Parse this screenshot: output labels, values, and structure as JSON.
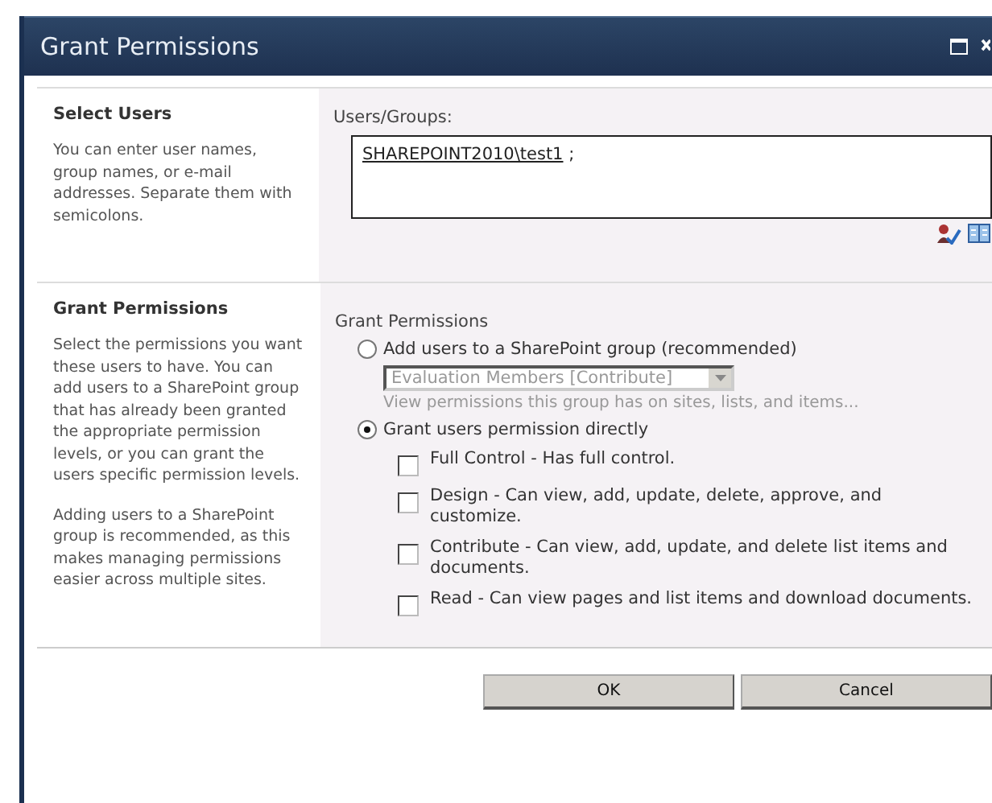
{
  "window": {
    "title": "Grant Permissions"
  },
  "sections": [
    {
      "heading": "Select Users",
      "paragraphs": [
        "You can enter user names, group names, or e-mail addresses. Separate them with semicolons."
      ]
    },
    {
      "heading": "Grant Permissions",
      "paragraphs": [
        "Select the permissions you want these users to have. You can add users to a SharePoint group that has already been granted the appropriate permission levels, or you can grant the users specific permission levels.",
        "Adding users to a SharePoint group is recommended, as this makes managing permissions easier across multiple sites."
      ]
    }
  ],
  "users": {
    "label": "Users/Groups:",
    "value": "SHAREPOINT2010\\test1",
    "separator": ";"
  },
  "grant": {
    "label": "Grant Permissions",
    "options": [
      {
        "label": "Add users to a SharePoint group (recommended)",
        "selected": false
      },
      {
        "label": "Grant users permission directly",
        "selected": true
      }
    ],
    "group_select": {
      "value": "Evaluation Members [Contribute]",
      "disabled": true
    },
    "group_hint": "View permissions this group has on sites, lists, and items...",
    "levels": [
      {
        "label": "Full Control - Has full control.",
        "checked": false
      },
      {
        "label": "Design - Can view, add, update, delete, approve, and customize.",
        "checked": false
      },
      {
        "label": "Contribute - Can view, add, update, and delete list items and documents.",
        "checked": false
      },
      {
        "label": "Read - Can view pages and list items and download documents.",
        "checked": false
      }
    ]
  },
  "buttons": [
    "OK",
    "Cancel"
  ]
}
